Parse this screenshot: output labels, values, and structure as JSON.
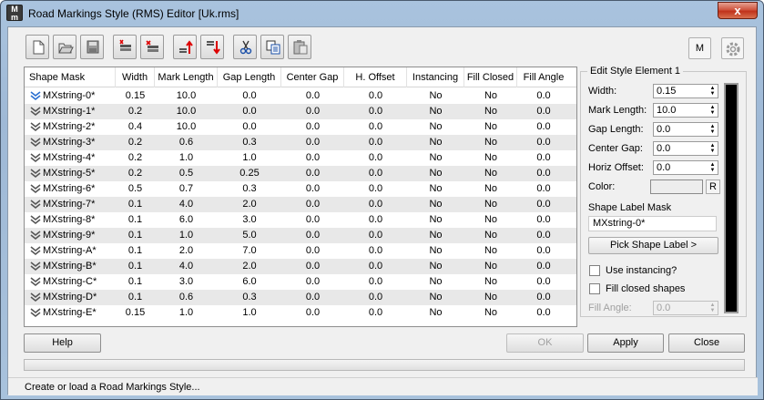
{
  "window": {
    "title": "Road Markings Style (RMS) Editor [Uk.rms]",
    "close_label": "x"
  },
  "toolbar": {
    "m_label": "M"
  },
  "grid": {
    "columns": [
      "Shape Mask",
      "Width",
      "Mark Length",
      "Gap Length",
      "Center Gap",
      "H. Offset",
      "Instancing",
      "Fill Closed",
      "Fill Angle"
    ],
    "rows": [
      [
        "MXstring-0*",
        "0.15",
        "10.0",
        "0.0",
        "0.0",
        "0.0",
        "No",
        "No",
        "0.0"
      ],
      [
        "MXstring-1*",
        "0.2",
        "10.0",
        "0.0",
        "0.0",
        "0.0",
        "No",
        "No",
        "0.0"
      ],
      [
        "MXstring-2*",
        "0.4",
        "10.0",
        "0.0",
        "0.0",
        "0.0",
        "No",
        "No",
        "0.0"
      ],
      [
        "MXstring-3*",
        "0.2",
        "0.6",
        "0.3",
        "0.0",
        "0.0",
        "No",
        "No",
        "0.0"
      ],
      [
        "MXstring-4*",
        "0.2",
        "1.0",
        "1.0",
        "0.0",
        "0.0",
        "No",
        "No",
        "0.0"
      ],
      [
        "MXstring-5*",
        "0.2",
        "0.5",
        "0.25",
        "0.0",
        "0.0",
        "No",
        "No",
        "0.0"
      ],
      [
        "MXstring-6*",
        "0.5",
        "0.7",
        "0.3",
        "0.0",
        "0.0",
        "No",
        "No",
        "0.0"
      ],
      [
        "MXstring-7*",
        "0.1",
        "4.0",
        "2.0",
        "0.0",
        "0.0",
        "No",
        "No",
        "0.0"
      ],
      [
        "MXstring-8*",
        "0.1",
        "6.0",
        "3.0",
        "0.0",
        "0.0",
        "No",
        "No",
        "0.0"
      ],
      [
        "MXstring-9*",
        "0.1",
        "1.0",
        "5.0",
        "0.0",
        "0.0",
        "No",
        "No",
        "0.0"
      ],
      [
        "MXstring-A*",
        "0.1",
        "2.0",
        "7.0",
        "0.0",
        "0.0",
        "No",
        "No",
        "0.0"
      ],
      [
        "MXstring-B*",
        "0.1",
        "4.0",
        "2.0",
        "0.0",
        "0.0",
        "No",
        "No",
        "0.0"
      ],
      [
        "MXstring-C*",
        "0.1",
        "3.0",
        "6.0",
        "0.0",
        "0.0",
        "No",
        "No",
        "0.0"
      ],
      [
        "MXstring-D*",
        "0.1",
        "0.6",
        "0.3",
        "0.0",
        "0.0",
        "No",
        "No",
        "0.0"
      ],
      [
        "MXstring-E*",
        "0.15",
        "1.0",
        "1.0",
        "0.0",
        "0.0",
        "No",
        "No",
        "0.0"
      ]
    ]
  },
  "panel": {
    "title": "Edit Style Element 1",
    "width_label": "Width:",
    "width_value": "0.15",
    "mark_label": "Mark Length:",
    "mark_value": "10.0",
    "gap_label": "Gap Length:",
    "gap_value": "0.0",
    "center_label": "Center Gap:",
    "center_value": "0.0",
    "horiz_label": "Horiz Offset:",
    "horiz_value": "0.0",
    "color_label": "Color:",
    "r_label": "R",
    "mask_label": "Shape Label Mask",
    "mask_value": "MXstring-0*",
    "pick_label": "Pick Shape Label  >",
    "instancing_label": "Use instancing?",
    "fill_closed_label": "Fill closed shapes",
    "fill_angle_label": "Fill Angle:",
    "fill_angle_value": "0.0"
  },
  "buttons": {
    "help": "Help",
    "ok": "OK",
    "apply": "Apply",
    "close": "Close"
  },
  "status": {
    "text": "Create or load a Road Markings Style..."
  }
}
